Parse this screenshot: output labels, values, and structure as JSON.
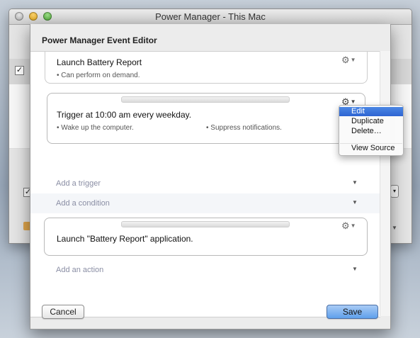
{
  "window": {
    "title": "Power Manager - This Mac"
  },
  "sheet": {
    "title": "Power Manager Event Editor"
  },
  "event_card": {
    "title": "Launch Battery Report",
    "bullets": [
      "Can perform on demand."
    ]
  },
  "trigger_card": {
    "title": "Trigger at 10:00 am every weekday.",
    "bullets": [
      "Wake up the computer.",
      "Suppress notifications."
    ]
  },
  "add_trigger": "Add a trigger",
  "add_condition": "Add a condition",
  "action_card": {
    "title": "Launch \"Battery Report\" application."
  },
  "add_action": "Add an action",
  "context_menu": {
    "items": [
      "Edit",
      "Duplicate",
      "Delete…",
      "View Source"
    ],
    "selected": "Edit"
  },
  "buttons": {
    "cancel": "Cancel",
    "save": "Save"
  },
  "icons": {
    "gear": "gear-icon",
    "dropdown": "dropdown-arrow-icon",
    "bullet": "•"
  },
  "colors": {
    "accent": "#2e64d2",
    "save_button": "#5fa0ec",
    "placeholder": "#8a8ea4"
  }
}
